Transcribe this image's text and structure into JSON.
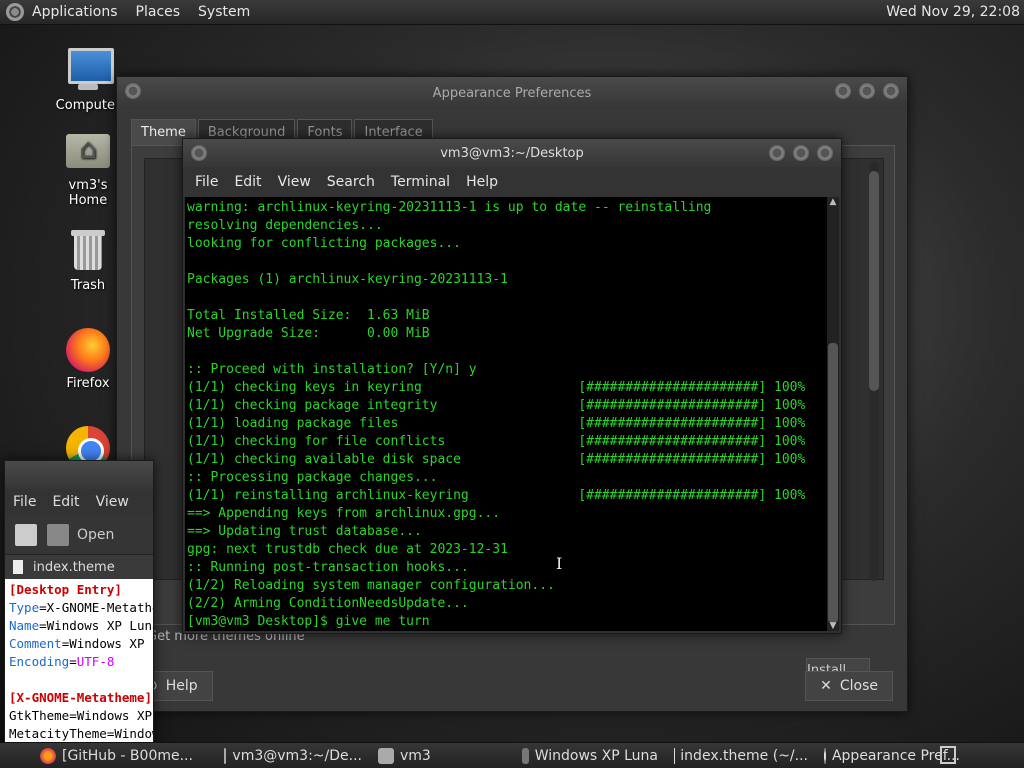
{
  "top_panel": {
    "menus": [
      "Applications",
      "Places",
      "System"
    ],
    "clock": "Wed Nov 29, 22:08"
  },
  "desktop_icons": [
    {
      "label": "Computer",
      "icon": "computer-icon"
    },
    {
      "label": "vm3's Home",
      "icon": "home-folder-icon"
    },
    {
      "label": "Trash",
      "icon": "trash-icon"
    },
    {
      "label": "Firefox",
      "icon": "firefox-icon"
    },
    {
      "label": "",
      "icon": "chrome-icon"
    }
  ],
  "appearance": {
    "title": "Appearance Preferences",
    "tabs": [
      "Theme",
      "Background",
      "Fonts",
      "Interface"
    ],
    "more_themes": "Get more themes online",
    "install_button": "Install...",
    "help_button": "Help",
    "close_button": "Close"
  },
  "editor": {
    "menus": [
      "File",
      "Edit",
      "View"
    ],
    "toolbar_open": "Open",
    "file_tab": "index.theme",
    "lines": [
      {
        "type": "sec",
        "text": "[Desktop Entry]"
      },
      {
        "type": "kv",
        "key": "Type",
        "val": "X-GNOME-Metatheme"
      },
      {
        "type": "kv",
        "key": "Name",
        "val": "Windows XP Luna"
      },
      {
        "type": "kv",
        "key": "Comment",
        "val": "Windows XP Luna"
      },
      {
        "type": "kv",
        "key": "Encoding",
        "val": "UTF-8"
      },
      {
        "type": "blank",
        "text": ""
      },
      {
        "type": "sec",
        "text": "[X-GNOME-Metatheme]"
      },
      {
        "type": "kv",
        "key": "GtkTheme",
        "val": "Windows XP Luna"
      },
      {
        "type": "kv",
        "key": "MetacityTheme",
        "val": "Windows XP Luna"
      }
    ]
  },
  "terminal": {
    "title": "vm3@vm3:~/Desktop",
    "menus": [
      "File",
      "Edit",
      "View",
      "Search",
      "Terminal",
      "Help"
    ],
    "lines": [
      "warning: archlinux-keyring-20231113-1 is up to date -- reinstalling",
      "resolving dependencies...",
      "looking for conflicting packages...",
      "",
      "Packages (1) archlinux-keyring-20231113-1",
      "",
      "Total Installed Size:  1.63 MiB",
      "Net Upgrade Size:      0.00 MiB",
      "",
      ":: Proceed with installation? [Y/n] y",
      "(1/1) checking keys in keyring                    [######################] 100%",
      "(1/1) checking package integrity                  [######################] 100%",
      "(1/1) loading package files                       [######################] 100%",
      "(1/1) checking for file conflicts                 [######################] 100%",
      "(1/1) checking available disk space               [######################] 100%",
      ":: Processing package changes...",
      "(1/1) reinstalling archlinux-keyring              [######################] 100%",
      "==> Appending keys from archlinux.gpg...",
      "==> Updating trust database...",
      "gpg: next trustdb check due at 2023-12-31",
      ":: Running post-transaction hooks...",
      "(1/2) Reloading system manager configuration...",
      "(2/2) Arming ConditionNeedsUpdate...",
      "[vm3@vm3 Desktop]$ give me turn"
    ]
  },
  "taskbar": {
    "tasks": [
      {
        "label": "[GitHub - B00me...",
        "icon": "firefox-icon"
      },
      {
        "label": "vm3@vm3:~/De...",
        "icon": "terminal-icon"
      },
      {
        "label": "vm3",
        "icon": "home-folder-icon"
      },
      {
        "label": "Windows XP Luna",
        "icon": "folder-icon"
      },
      {
        "label": "index.theme (~/...",
        "icon": "text-editor-icon"
      },
      {
        "label": "Appearance Pref...",
        "icon": "appearance-icon"
      }
    ]
  }
}
